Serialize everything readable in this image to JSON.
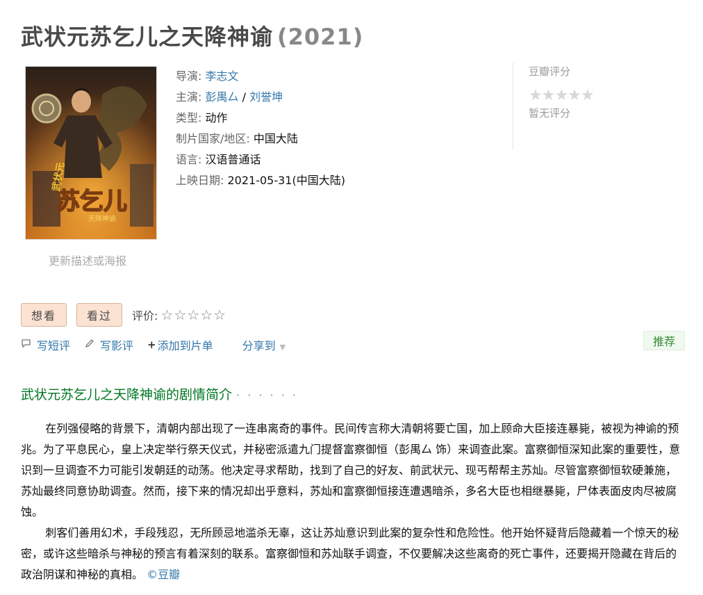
{
  "movie": {
    "title": "武状元苏乞儿之天降神谕",
    "year": "(2021)"
  },
  "poster": {
    "alt_icon": "movie-poster"
  },
  "update_link": "更新描述或海报",
  "info": {
    "director_label": "导演:",
    "director": "李志文",
    "cast_label": "主演:",
    "cast_1": "彭禺厶",
    "cast_sep": " / ",
    "cast_2": "刘誉坤",
    "genre_label": "类型:",
    "genre": "动作",
    "country_label": "制片国家/地区:",
    "country": "中国大陆",
    "language_label": "语言:",
    "language": "汉语普通话",
    "release_label": "上映日期:",
    "release": "2021-05-31(中国大陆)"
  },
  "rating": {
    "label": "豆瓣评分",
    "stars": "★★★★★",
    "none_text": "暂无评分"
  },
  "actions": {
    "want": "想看",
    "watched": "看过",
    "rate_label": "评价:",
    "rate_stars": "☆☆☆☆☆"
  },
  "links": {
    "short_review": "写短评",
    "review": "写影评",
    "add_list": "添加到片单",
    "share": "分享到"
  },
  "recommend": "推荐",
  "summary": {
    "heading": "武状元苏乞儿之天降神谕的剧情简介",
    "heading_dots": "· · · · · ·",
    "p1": "在列强侵略的背景下，清朝内部出现了一连串离奇的事件。民间传言称大清朝将要亡国，加上顾命大臣接连暴毙，被视为神谕的预兆。为了平息民心，皇上决定举行祭天仪式，并秘密派遣九门提督富察御恒（彭禺厶 饰）来调查此案。富察御恒深知此案的重要性，意识到一旦调查不力可能引发朝廷的动荡。他决定寻求帮助，找到了自己的好友、前武状元、现丐帮帮主苏灿。尽管富察御恒软硬兼施，苏灿最终同意协助调查。然而，接下来的情况却出乎意料，苏灿和富察御恒接连遭遇暗杀，多名大臣也相继暴毙，尸体表面皮肉尽被腐蚀。",
    "p2": "刺客们善用幻术，手段残忍，无所顾忌地滥杀无辜，这让苏灿意识到此案的复杂性和危险性。他开始怀疑背后隐藏着一个惊天的秘密，或许这些暗杀与神秘的预言有着深刻的联系。富察御恒和苏灿联手调查，不仅要解决这些离奇的死亡事件，还要揭开隐藏在背后的政治阴谋和神秘的真相。",
    "copyright": "©豆瓣"
  }
}
